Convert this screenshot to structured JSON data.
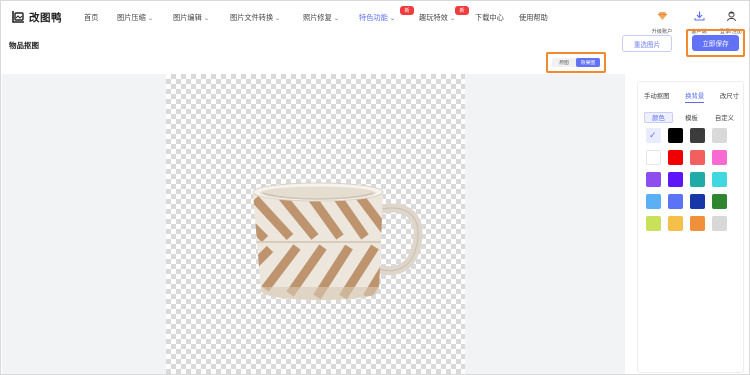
{
  "app": {
    "name": "改图鸭"
  },
  "nav": {
    "items": [
      {
        "label": "首页",
        "chevron": false
      },
      {
        "label": "图片压缩",
        "chevron": true
      },
      {
        "label": "图片编辑",
        "chevron": true
      },
      {
        "label": "图片文件转换",
        "chevron": true
      },
      {
        "label": "照片修复",
        "chevron": true
      },
      {
        "label": "特色功能",
        "chevron": true,
        "active": true,
        "badge": "新"
      },
      {
        "label": "趣玩特效",
        "chevron": true,
        "badge": "新"
      },
      {
        "label": "下载中心",
        "chevron": false
      },
      {
        "label": "使用帮助",
        "chevron": false
      }
    ],
    "right": [
      {
        "label": "升级账户",
        "icon": "diamond-icon"
      },
      {
        "label": "客户端",
        "icon": "download-icon"
      },
      {
        "label": "登录/注册",
        "icon": "user-avatar-icon"
      }
    ]
  },
  "page": {
    "title": "物品抠图",
    "reselect_label": "重选图片",
    "save_label": "立即保存",
    "view_toggle": {
      "original": "原图",
      "result": "效果图",
      "selected": "效果图"
    }
  },
  "panel": {
    "tabs": [
      {
        "label": "手动抠图",
        "active": false
      },
      {
        "label": "换背景",
        "active": true
      },
      {
        "label": "改尺寸",
        "active": false
      }
    ],
    "subtabs": [
      {
        "label": "颜色",
        "active": true
      },
      {
        "label": "模板",
        "active": false
      },
      {
        "label": "自定义",
        "active": false
      }
    ],
    "colors": [
      "transparent",
      "#000000",
      "#3c3c3c",
      "#d9d9d9",
      "#ffffff",
      "#f00000",
      "#f25f5f",
      "#f76ad2",
      "#8f4df0",
      "#5d16f5",
      "#20aaa8",
      "#40d8e0",
      "#5bb0f5",
      "#5b74f5",
      "#1637a8",
      "#2f8530",
      "#c9e05a",
      "#f5c04a",
      "#f0903a",
      "#d8d8d8"
    ],
    "selected_color": "transparent"
  },
  "colors": {
    "accent": "#6272f5",
    "highlight": "#f08a2c",
    "badge": "#f03c3c"
  }
}
